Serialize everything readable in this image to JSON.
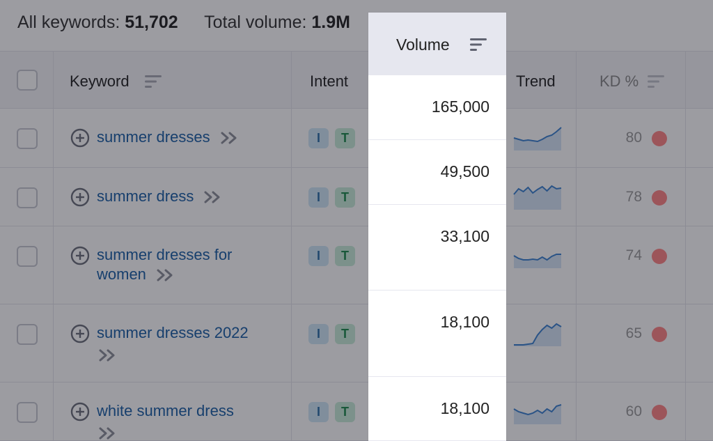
{
  "summary": {
    "all_keywords_label": "All keywords:",
    "all_keywords_value": "51,702",
    "total_volume_label": "Total volume:",
    "total_volume_value": "1.9M"
  },
  "columns": {
    "keyword": "Keyword",
    "intent": "Intent",
    "volume": "Volume",
    "trend": "Trend",
    "kd": "KD %"
  },
  "rows": [
    {
      "keyword": "summer dresses",
      "intent": [
        "I",
        "T"
      ],
      "volume": "165,000",
      "kd": "80",
      "trend": [
        18,
        20,
        22,
        21,
        22,
        23,
        20,
        16,
        14,
        9,
        3
      ]
    },
    {
      "keyword": "summer dress",
      "intent": [
        "I",
        "T"
      ],
      "volume": "49,500",
      "kd": "78",
      "trend": [
        14,
        6,
        10,
        4,
        12,
        7,
        3,
        9,
        2,
        6,
        5
      ]
    },
    {
      "keyword": "summer dresses for women",
      "intent": [
        "I",
        "T"
      ],
      "volume": "33,100",
      "kd": "74",
      "trend": [
        18,
        22,
        24,
        24,
        23,
        24,
        20,
        24,
        19,
        16,
        16
      ]
    },
    {
      "keyword": "summer dresses 2022",
      "intent": [
        "I",
        "T"
      ],
      "volume": "18,100",
      "kd": "65",
      "trend": [
        34,
        34,
        34,
        33,
        32,
        20,
        12,
        6,
        10,
        4,
        8
      ]
    },
    {
      "keyword": "white summer dress",
      "intent": [
        "I",
        "T"
      ],
      "volume": "18,100",
      "kd": "60",
      "trend": [
        14,
        18,
        20,
        22,
        20,
        16,
        20,
        14,
        18,
        10,
        8
      ]
    }
  ],
  "colors": {
    "link": "#1a5fa6",
    "intent_informational_bg": "#cfe7f7",
    "intent_transactional_bg": "#c9ecd9",
    "kd_dot": "#ff8585"
  }
}
